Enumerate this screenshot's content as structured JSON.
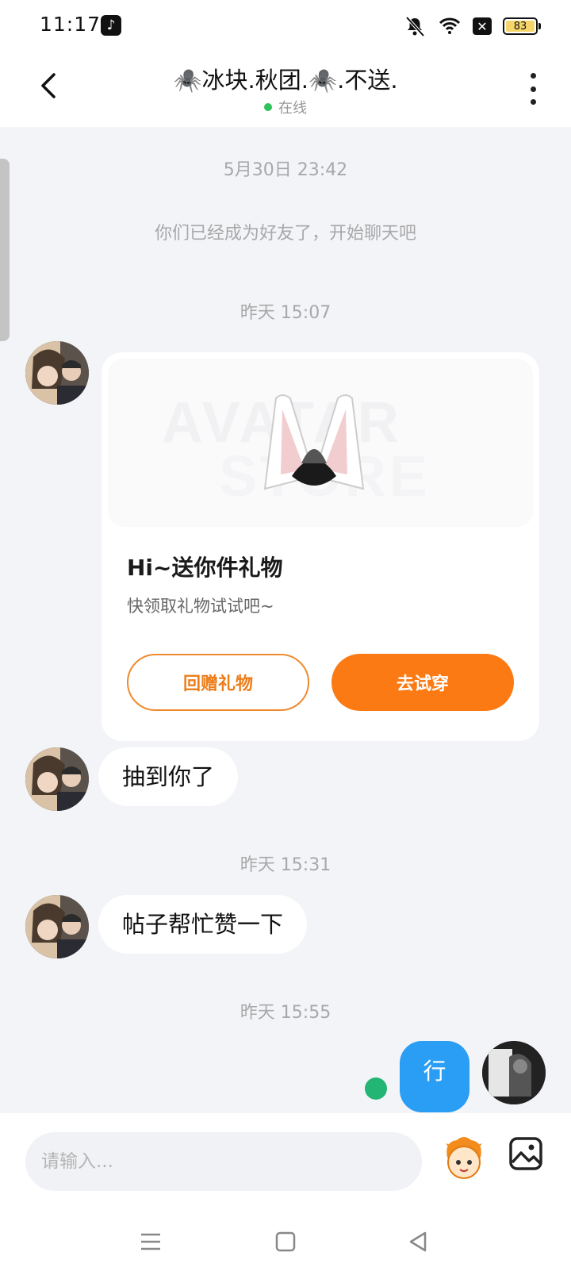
{
  "status_bar": {
    "time": "11:17",
    "battery": "83"
  },
  "header": {
    "title": "🕷️冰块.秋团.🕷️.不送.",
    "status": "在线"
  },
  "messages": {
    "ts_1": "5月30日 23:42",
    "system": "你们已经成为好友了，开始聊天吧",
    "ts_2": "昨天 15:07",
    "gift_card": {
      "title": "Hi~送你件礼物",
      "subtitle": "快领取礼物试试吧~",
      "return_label": "回赠礼物",
      "try_label": "去试穿",
      "watermark_top": "AVATAR",
      "watermark_bottom": "STORE"
    },
    "msg_1": "抽到你了",
    "ts_3": "昨天 15:31",
    "msg_2": "帖子帮忙赞一下",
    "ts_4": "昨天 15:55",
    "msg_3": "行"
  },
  "input": {
    "placeholder": "请输入..."
  },
  "colors": {
    "accent_orange": "#fb7a13",
    "bubble_blue": "#2a9df4",
    "online_green": "#2fc25b"
  }
}
